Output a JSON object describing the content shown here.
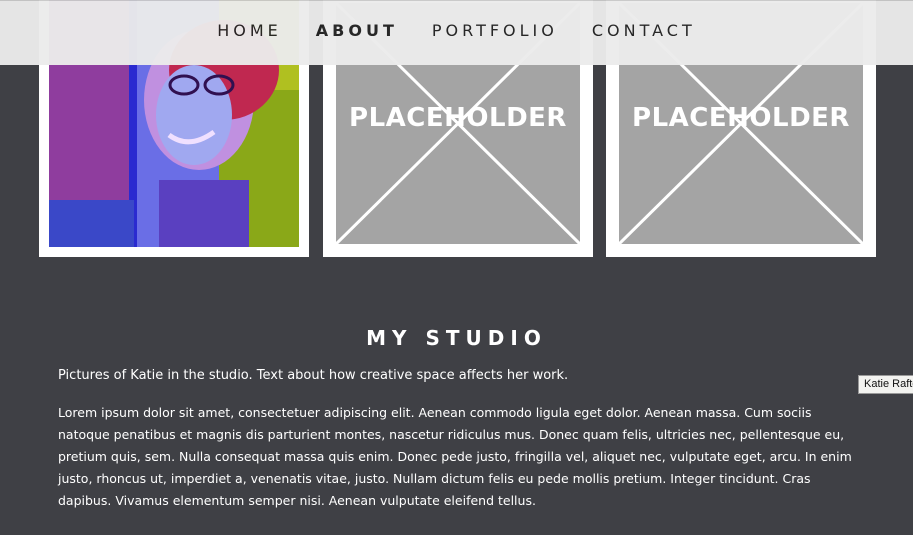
{
  "nav": {
    "items": [
      {
        "label": "HOME",
        "active": false
      },
      {
        "label": "ABOUT",
        "active": true
      },
      {
        "label": "PORTFOLIO",
        "active": false
      },
      {
        "label": "CONTACT",
        "active": false
      }
    ]
  },
  "gallery": {
    "placeholder_label": "PLACEHOLDER"
  },
  "studio": {
    "title": "MY STUDIO",
    "intro": "Pictures of Katie in the studio. Text about how creative space affects her work.",
    "body": "Lorem ipsum dolor sit amet, consectetuer adipiscing elit. Aenean commodo ligula eget dolor. Aenean massa. Cum sociis natoque penatibus et magnis dis parturient montes, nascetur ridiculus mus. Donec quam felis, ultricies nec, pellentesque eu, pretium quis, sem. Nulla consequat massa quis enim. Donec pede justo, fringilla vel, aliquet nec, vulputate eget, arcu. In enim justo, rhoncus ut, imperdiet a, venenatis vitae, justo. Nullam dictum felis eu pede mollis pretium. Integer tincidunt. Cras dapibus. Vivamus elementum semper nisi. Aenean vulputate eleifend tellus."
  },
  "tooltip": {
    "text": "Katie Rafter"
  },
  "colors": {
    "background": "#3f4045",
    "nav_background": "#ececec",
    "placeholder_gray": "#a4a4a4",
    "frame_white": "#ffffff"
  }
}
